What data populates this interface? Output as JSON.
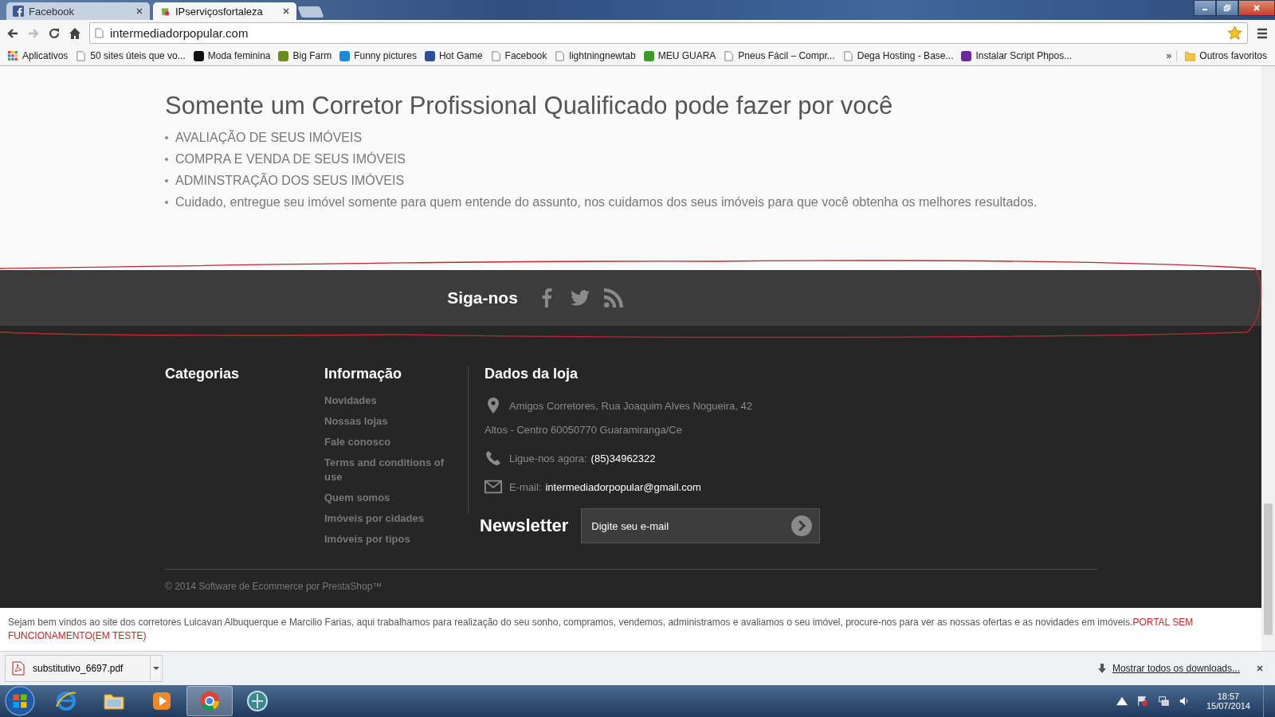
{
  "browser": {
    "tabs": [
      {
        "title": "Facebook",
        "kind": "facebook",
        "selected": false
      },
      {
        "title": "IPserviçosfortaleza",
        "kind": "site",
        "selected": true
      }
    ],
    "address": "intermediadorpopular.com",
    "bookmarks": [
      {
        "label": "Aplicativos",
        "kind": "apps"
      },
      {
        "label": "50 sites úteis que vo...",
        "kind": "page"
      },
      {
        "label": "Moda feminina",
        "kind": "logo",
        "color": "#111111"
      },
      {
        "label": "Big Farm",
        "kind": "logo",
        "color": "#6a8a1c"
      },
      {
        "label": "Funny pictures",
        "kind": "logo",
        "color": "#1e88d6"
      },
      {
        "label": "Hot Game",
        "kind": "logo",
        "color": "#2a4d9c"
      },
      {
        "label": "Facebook",
        "kind": "page"
      },
      {
        "label": "lightningnewtab",
        "kind": "page"
      },
      {
        "label": "MEU GUARA",
        "kind": "logo",
        "color": "#3a9a2a"
      },
      {
        "label": "Pneus Fácil – Compr...",
        "kind": "page"
      },
      {
        "label": "Dega Hosting - Base...",
        "kind": "page"
      },
      {
        "label": "Instalar Script Phpos...",
        "kind": "logo",
        "color": "#6a2a9a"
      }
    ],
    "overflow": "»",
    "other_bookmarks": "Outros favoritos"
  },
  "page": {
    "heading": "Somente um Corretor Profissional Qualificado pode fazer por você",
    "list": [
      "AVALIAÇÃO DE SEUS IMÓVEIS",
      "COMPRA E VENDA DE SEUS IMÓVEIS",
      "ADMINSTRAÇÃO DOS SEUS IMÓVEIS",
      "Cuidado, entregue seu imóvel somente para quem entende do assunto, nos cuidamos dos seus imóveis para que você obtenha os melhores resultados."
    ]
  },
  "social": {
    "title": "Siga-nos"
  },
  "footer": {
    "categories_title": "Categorias",
    "info_title": "Informação",
    "info_links": [
      "Novidades",
      "Nossas lojas",
      "Fale conosco",
      "Terms and conditions of use",
      "Quem somos",
      "Imóveis por cidades",
      "Imóveis por tipos"
    ],
    "store_title": "Dados da loja",
    "address_line_1": "Amigos Corretores, Rua Joaquim Alves Nogueira, 42",
    "address_line_2": "Altos - Centro 60050770 Guaramiranga/Ce",
    "phone_label": "Ligue-nos agora:",
    "phone": "(85)34962322",
    "email_label": "E-mail:",
    "email": "intermediadorpopular@gmail.com",
    "newsletter_title": "Newsletter",
    "newsletter": {
      "placeholder": "Digite seu e-mail"
    },
    "copyright": "© 2014 Software de Ecommerce por PrestaShop™"
  },
  "notice": {
    "text": "Sejam bem vindos ao site dos corretores Luicavan Albuquerque e Marcilio Farias, aqui trabalhamos para realização do seu sonho, compramos, vendemos, administramos e avaliamos o seu imóvel, procure-nos para ver as nossas ofertas e as novidades em imóveis.",
    "alert": "PORTAL SEM FUNCIONAMENTO(EM TESTE)"
  },
  "downloads": {
    "file": "substitutivo_6697.pdf",
    "show_all": "Mostrar todos os downloads..."
  },
  "taskbar": {
    "apps": [
      {
        "kind": "ie",
        "selected": false
      },
      {
        "kind": "folder",
        "selected": false
      },
      {
        "kind": "media",
        "selected": false
      },
      {
        "kind": "chrome",
        "selected": true
      },
      {
        "kind": "globe",
        "selected": false
      }
    ],
    "time": "18:57",
    "date": "15/07/2014"
  }
}
